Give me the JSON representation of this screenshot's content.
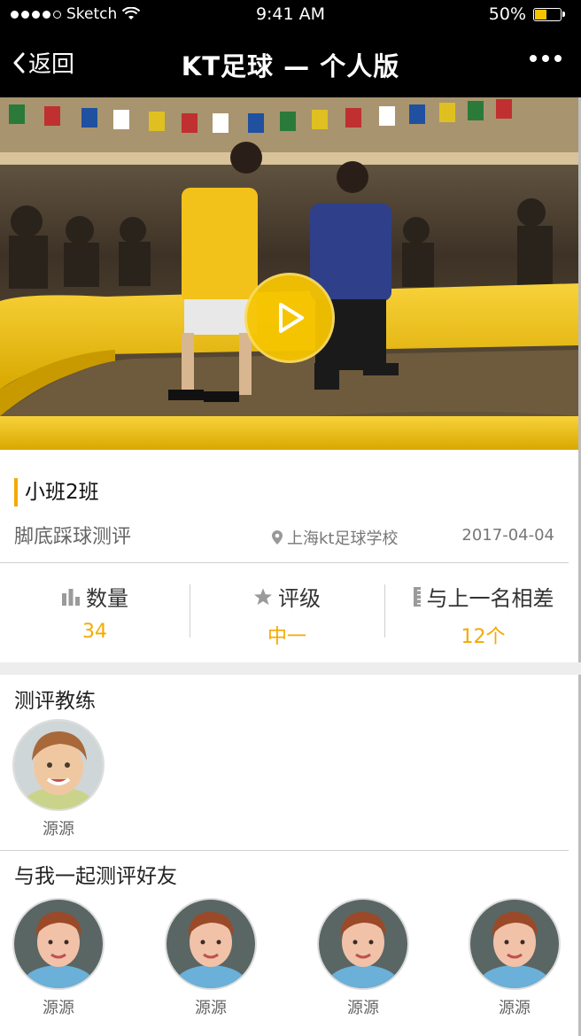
{
  "status_bar": {
    "carrier": "Sketch",
    "time": "9:41 AM",
    "battery_percent": "50%",
    "battery_level": 0.5,
    "signal_bars": 4
  },
  "nav": {
    "back_label": "返回",
    "title": "KT足球 — 个人版"
  },
  "hero": {
    "type": "video",
    "play_icon": "play-icon",
    "accent_color": "#f5c400"
  },
  "evaluation": {
    "class_name": "小班2班",
    "test_name": "脚底踩球测评",
    "location": "上海kt足球学校",
    "date": "2017-04-04"
  },
  "stats": [
    {
      "icon": "bar-chart-icon",
      "label": "数量",
      "value": "34"
    },
    {
      "icon": "star-icon",
      "label": "评级",
      "value": "中一"
    },
    {
      "icon": "ruler-icon",
      "label": "与上一名相差",
      "value": "12个"
    }
  ],
  "coaches": {
    "title": "测评教练",
    "items": [
      {
        "name": "源源"
      }
    ]
  },
  "friends": {
    "title": "与我一起测评好友",
    "items": [
      {
        "name": "源源"
      },
      {
        "name": "源源"
      },
      {
        "name": "源源"
      },
      {
        "name": "源源"
      }
    ]
  },
  "colors": {
    "accent": "#f5a900",
    "bar_bg": "#000000",
    "divider": "#cfcfcf"
  }
}
